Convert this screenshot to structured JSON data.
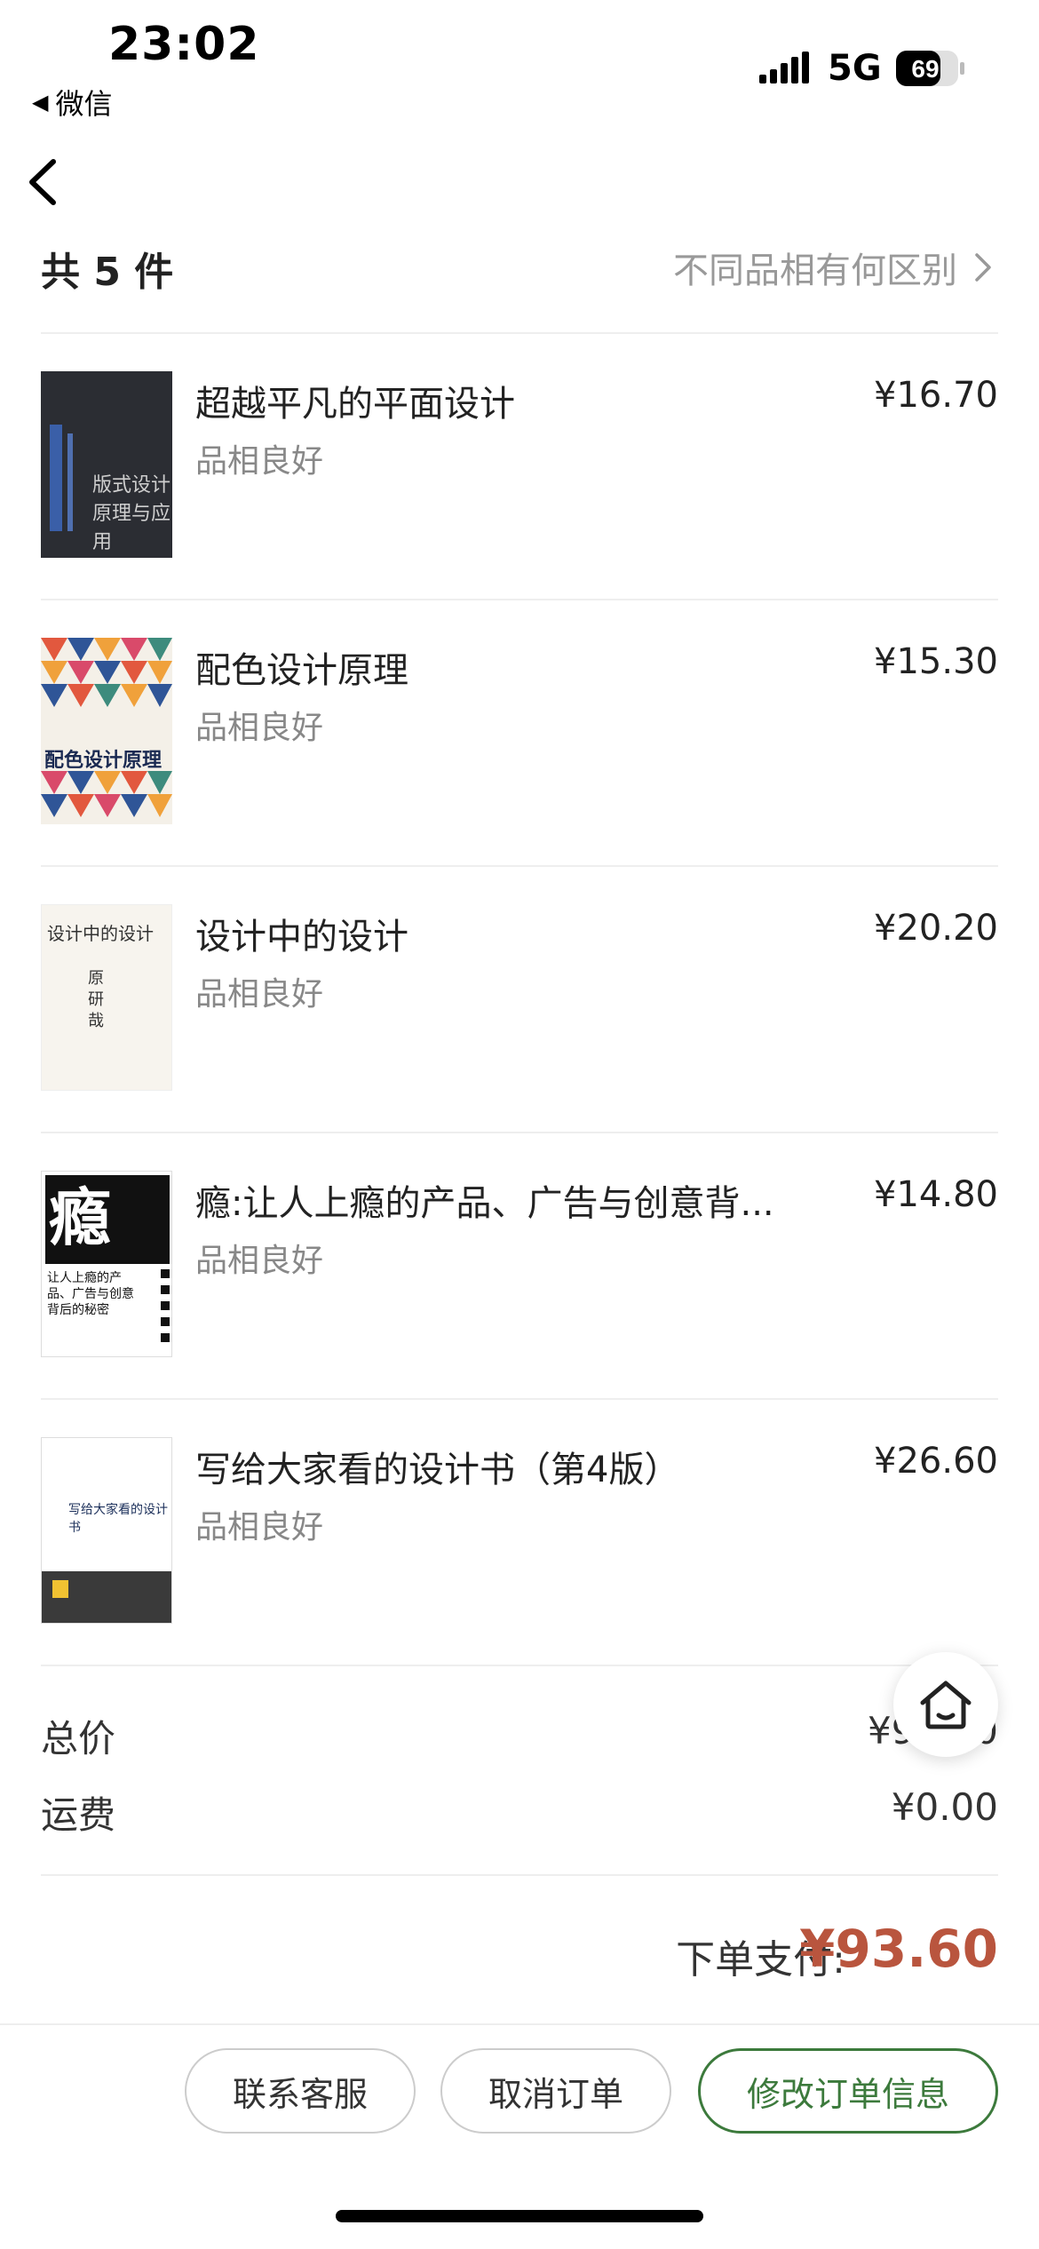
{
  "status_bar": {
    "time": "23:02",
    "back_app": "微信",
    "network": "5G",
    "battery": "69"
  },
  "header": {
    "count_label": "共 5 件",
    "compare_link": "不同品相有何区别"
  },
  "items": [
    {
      "title": "超越平凡的平面设计",
      "condition": "品相良好",
      "price": "¥16.70",
      "cover_text": "版式设计 原理与应用"
    },
    {
      "title": "配色设计原理",
      "condition": "品相良好",
      "price": "¥15.30",
      "cover_text": "配色设计原理"
    },
    {
      "title": "设计中的设计",
      "condition": "品相良好",
      "price": "¥20.20",
      "cover_text": "设计中的设计",
      "cover_author": "原研哉"
    },
    {
      "title": "瘾:让人上瘾的产品、广告与创意背...",
      "condition": "品相良好",
      "price": "¥14.80",
      "cover_text": "瘾",
      "cover_sub": "让人上瘾的产品、广告与创意背后的秘密"
    },
    {
      "title": "写给大家看的设计书（第4版）",
      "condition": "品相良好",
      "price": "¥26.60",
      "cover_text": "写给大家看的设计书"
    }
  ],
  "totals": {
    "total_label": "总价",
    "total_value": "¥93.60",
    "shipping_label": "运费",
    "shipping_value": "¥0.00",
    "pay_label": "下单支付:",
    "pay_amount": "¥93.60"
  },
  "actions": {
    "contact": "联系客服",
    "cancel": "取消订单",
    "modify": "修改订单信息"
  },
  "icons": {
    "back": "chevron-left-icon",
    "home": "home-icon",
    "arrow": "chevron-right-icon"
  },
  "colors": {
    "price_accent": "#b9553e",
    "primary_green": "#3c7a3c"
  }
}
